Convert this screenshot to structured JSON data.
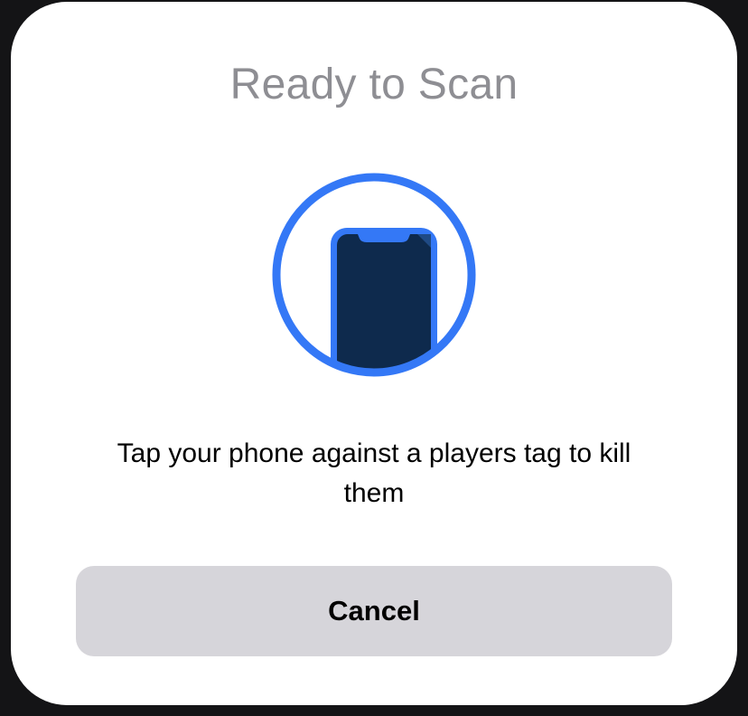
{
  "sheet": {
    "title": "Ready to Scan",
    "graphic_icon": "phone-nfc-scan-icon",
    "message": "Tap your phone against a players tag to kill them",
    "cancel_label": "Cancel"
  },
  "colors": {
    "accent": "#3478f6",
    "phone_body": "#0e2a4d",
    "title_gray": "#8e8e93",
    "button_bg": "#d6d5da",
    "sheet_bg": "#ffffff"
  }
}
